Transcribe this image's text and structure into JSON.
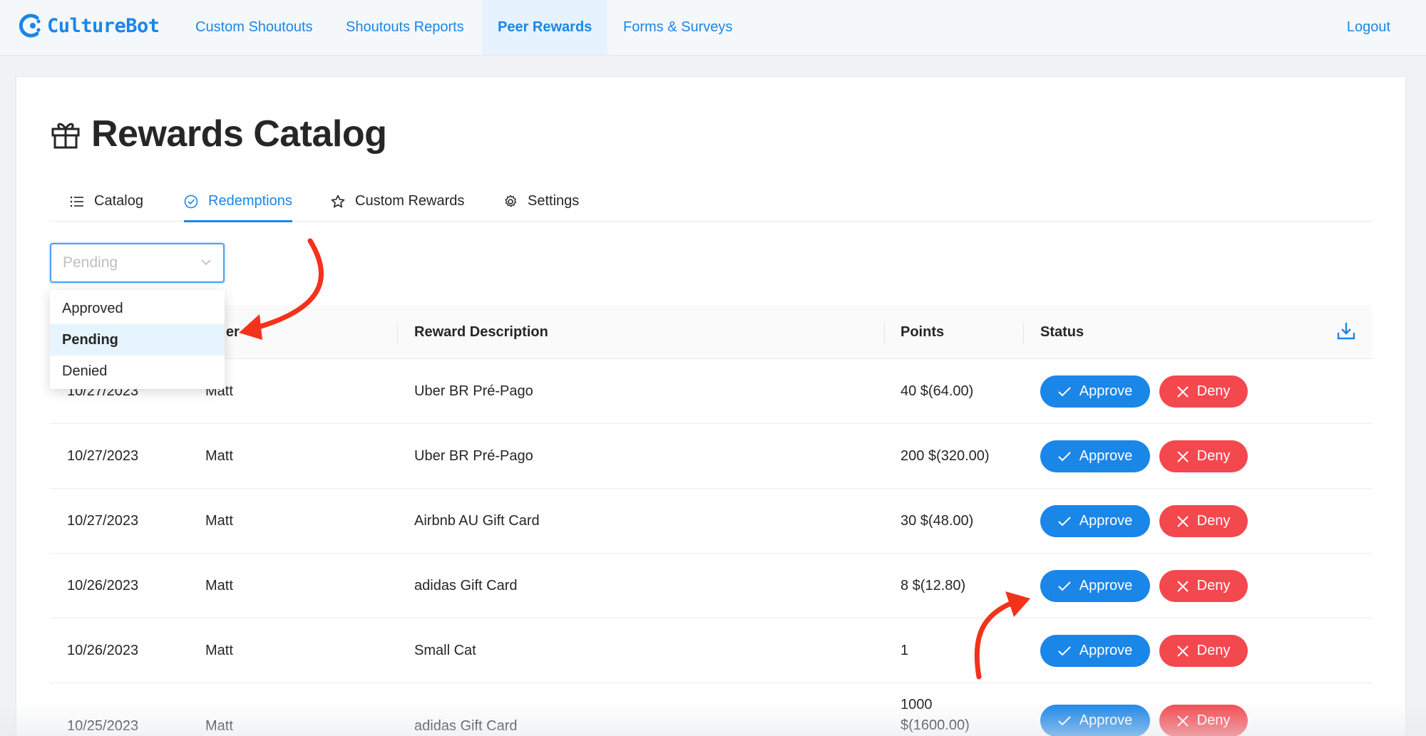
{
  "brand": {
    "name": "CultureBot",
    "color": "#1a86e8"
  },
  "nav": {
    "items": [
      {
        "label": "Custom Shoutouts",
        "active": false
      },
      {
        "label": "Shoutouts Reports",
        "active": false
      },
      {
        "label": "Peer Rewards",
        "active": true
      },
      {
        "label": "Forms & Surveys",
        "active": false
      }
    ],
    "logout": "Logout"
  },
  "page": {
    "title": "Rewards Catalog",
    "title_icon": "gift-icon"
  },
  "tabs": [
    {
      "label": "Catalog",
      "icon": "list-icon",
      "active": false
    },
    {
      "label": "Redemptions",
      "icon": "check-circle-icon",
      "active": true
    },
    {
      "label": "Custom Rewards",
      "icon": "star-icon",
      "active": false
    },
    {
      "label": "Settings",
      "icon": "gear-icon",
      "active": false
    }
  ],
  "filter": {
    "placeholder": "Pending",
    "options": [
      "Approved",
      "Pending",
      "Denied"
    ],
    "highlighted": "Pending"
  },
  "table": {
    "headers": {
      "redeemer": "Redeemer",
      "description": "Reward Description",
      "points": "Points",
      "status": "Status"
    },
    "header_redeemer_visible": "de    er",
    "rows": [
      {
        "date": "10/27/2023",
        "redeemer": "Matt",
        "description": "Uber BR Pré-Pago",
        "points": "40 $(64.00)"
      },
      {
        "date": "10/27/2023",
        "redeemer": "Matt",
        "description": "Uber BR Pré-Pago",
        "points": "200 $(320.00)"
      },
      {
        "date": "10/27/2023",
        "redeemer": "Matt",
        "description": "Airbnb AU Gift Card",
        "points": "30 $(48.00)"
      },
      {
        "date": "10/26/2023",
        "redeemer": "Matt",
        "description": "adidas Gift Card",
        "points": "8 $(12.80)"
      },
      {
        "date": "10/26/2023",
        "redeemer": "Matt",
        "description": "Small Cat",
        "points": "1"
      },
      {
        "date": "10/25/2023",
        "redeemer": "Matt",
        "description": "adidas Gift Card",
        "points_line1": "1000",
        "points_line2": "$(1600.00)"
      }
    ],
    "approve_label": "Approve",
    "deny_label": "Deny"
  },
  "colors": {
    "approve": "#1a86e8",
    "deny": "#f4484f",
    "annotation": "#f3321b"
  }
}
